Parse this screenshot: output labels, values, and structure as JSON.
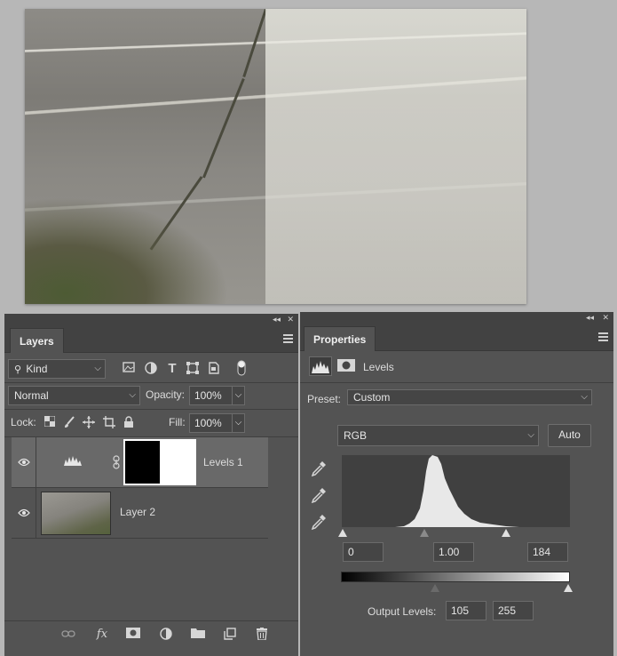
{
  "layers_panel": {
    "tab": "Layers",
    "filter_kind": "Kind",
    "blend_mode": "Normal",
    "opacity_label": "Opacity:",
    "opacity_value": "100%",
    "lock_label": "Lock:",
    "fill_label": "Fill:",
    "fill_value": "100%",
    "layers": [
      {
        "name": "Levels 1"
      },
      {
        "name": "Layer 2"
      }
    ]
  },
  "properties_panel": {
    "tab": "Properties",
    "adjustment_name": "Levels",
    "preset_label": "Preset:",
    "preset_value": "Custom",
    "channel": "RGB",
    "auto_label": "Auto",
    "input_black": "0",
    "input_gamma": "1.00",
    "input_white": "184",
    "output_label": "Output Levels:",
    "output_black": "105",
    "output_white": "255"
  },
  "colors": {
    "panel_bg": "#535353",
    "panel_header": "#424242",
    "selected_row": "#696969",
    "workspace": "#b7b7b7"
  }
}
